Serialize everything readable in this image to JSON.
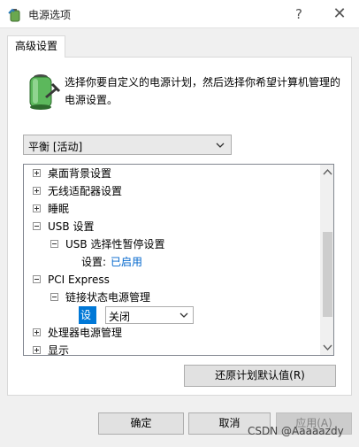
{
  "window": {
    "title": "电源选项",
    "help_label": "?",
    "close_label": "✕"
  },
  "tab": {
    "label": "高级设置"
  },
  "description": "选择你要自定义的电源计划，然后选择你希望计算机管理的电源设置。",
  "plan_select": {
    "value": "平衡 [活动]"
  },
  "tree": {
    "items": [
      {
        "label": "桌面背景设置",
        "expander": "plus"
      },
      {
        "label": "无线适配器设置",
        "expander": "plus"
      },
      {
        "label": "睡眠",
        "expander": "plus"
      },
      {
        "label": "USB 设置",
        "expander": "minus"
      },
      {
        "label": "USB 选择性暂停设置",
        "expander": "minus"
      },
      {
        "label": "设置:",
        "value": "已启用"
      },
      {
        "label": "PCI Express",
        "expander": "minus"
      },
      {
        "label": "链接状态电源管理",
        "expander": "minus"
      },
      {
        "label": "处理器电源管理",
        "expander": "plus"
      },
      {
        "label": "显示",
        "expander": "plus"
      }
    ],
    "inline_setting": {
      "label": "设置:",
      "value": "关闭"
    }
  },
  "buttons": {
    "restore": "还原计划默认值(R)",
    "ok": "确定",
    "cancel": "取消",
    "apply": "应用(A)"
  },
  "watermark": "CSDN @Aaaaazdy",
  "colors": {
    "highlight": "#0078d7",
    "link": "#0066cc",
    "disabled_text": "#838383"
  }
}
